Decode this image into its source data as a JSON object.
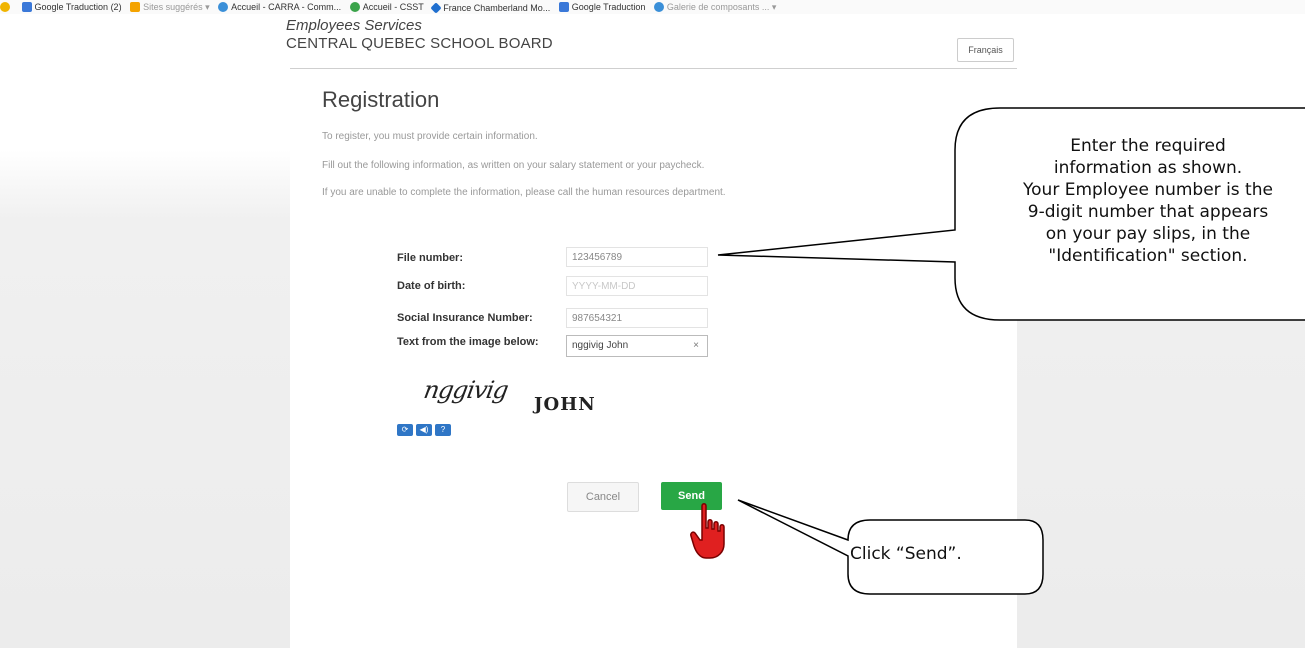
{
  "favorites": [
    {
      "icon": "star-icon",
      "label": ""
    },
    {
      "icon": "google-translate-icon",
      "label": "Google Traduction (2)"
    },
    {
      "icon": "suggested-sites-icon",
      "label": "Sites suggérés ▾"
    },
    {
      "icon": "ie-page-icon",
      "label": "Accueil - CARRA - Comm..."
    },
    {
      "icon": "csst-icon",
      "label": "Accueil - CSST"
    },
    {
      "icon": "france-chamberland-icon",
      "label": "France Chamberland  Mo..."
    },
    {
      "icon": "google-translate-icon",
      "label": "Google Traduction"
    },
    {
      "icon": "ie-page-icon",
      "label": "Galerie de composants ... ▾"
    }
  ],
  "header": {
    "subtitle": "Employees Services",
    "title": "CENTRAL QUEBEC SCHOOL BOARD",
    "language_button": "Français"
  },
  "registration": {
    "title": "Registration",
    "intro": [
      "To register, you must provide certain information.",
      "Fill out the following information, as written on your salary statement or your paycheck.",
      "If you are unable to complete the information, please call the human resources department."
    ]
  },
  "form": {
    "file_number": {
      "label": "File number:",
      "value": "123456789"
    },
    "date_of_birth": {
      "label": "Date of birth:",
      "placeholder": "YYYY-MM-DD"
    },
    "sin": {
      "label": "Social Insurance Number:",
      "value": "987654321"
    },
    "captcha": {
      "label": "Text from the image below:",
      "value": "nggivig John",
      "clear": "×"
    }
  },
  "captcha_image": {
    "word1": "nggivig",
    "word2": "JOHN"
  },
  "captcha_controls": [
    "refresh-icon",
    "audio-icon",
    "help-icon"
  ],
  "buttons": {
    "cancel": "Cancel",
    "send": "Send"
  },
  "callouts": {
    "info_lines": [
      "Enter the required",
      "information as shown.",
      "Your Employee number is the",
      "9-digit number that appears",
      "on your pay slips, in the",
      "\"Identification\" section."
    ],
    "send_hint": "Click “Send”."
  },
  "colors": {
    "send_button": "#28a745",
    "cursor_hand": "#e02020",
    "captcha_icons": "#2f76c6"
  }
}
